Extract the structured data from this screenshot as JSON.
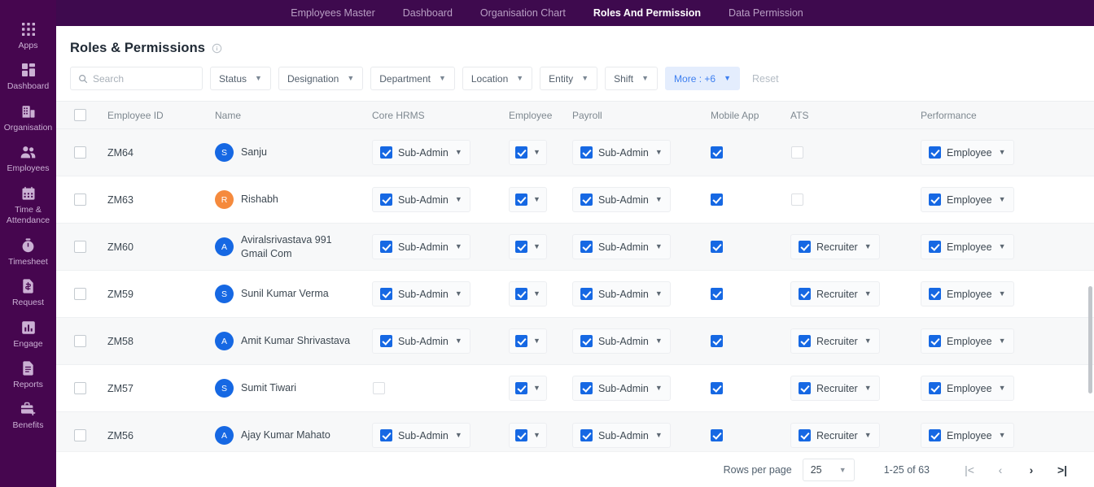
{
  "topnav": {
    "items": [
      {
        "label": "Employees Master",
        "active": false
      },
      {
        "label": "Dashboard",
        "active": false
      },
      {
        "label": "Organisation Chart",
        "active": false
      },
      {
        "label": "Roles And Permission",
        "active": true
      },
      {
        "label": "Data Permission",
        "active": false
      }
    ]
  },
  "sidebar": {
    "items": [
      {
        "label": "Apps",
        "icon": "apps-grid-icon"
      },
      {
        "label": "Dashboard",
        "icon": "dashboard-icon"
      },
      {
        "label": "Organisation",
        "icon": "building-icon"
      },
      {
        "label": "Employees",
        "icon": "people-icon"
      },
      {
        "label": "Time & Attendance",
        "icon": "calendar-icon"
      },
      {
        "label": "Timesheet",
        "icon": "stopwatch-icon"
      },
      {
        "label": "Request",
        "icon": "money-doc-icon"
      },
      {
        "label": "Engage",
        "icon": "bar-chart-icon"
      },
      {
        "label": "Reports",
        "icon": "document-icon"
      },
      {
        "label": "Benefits",
        "icon": "briefcase-plus-icon"
      }
    ]
  },
  "header": {
    "title": "Roles & Permissions",
    "info_icon": "info-circle-icon"
  },
  "filters": {
    "search_placeholder": "Search",
    "search_value": "",
    "chips": [
      {
        "label": "Status",
        "highlight": false
      },
      {
        "label": "Designation",
        "highlight": false
      },
      {
        "label": "Department",
        "highlight": false
      },
      {
        "label": "Location",
        "highlight": false
      },
      {
        "label": "Entity",
        "highlight": false
      },
      {
        "label": "Shift",
        "highlight": false
      },
      {
        "label": "More : +6",
        "highlight": true
      }
    ],
    "reset_label": "Reset"
  },
  "table": {
    "columns": [
      "Employee ID",
      "Name",
      "Core HRMS",
      "Employee",
      "Payroll",
      "Mobile App",
      "ATS",
      "Performance"
    ],
    "header_select_all": false,
    "rows": [
      {
        "selected": false,
        "employee_id": "ZM64",
        "name": "Sanju",
        "avatar_letter": "S",
        "avatar_color": "#1668e3",
        "core_hrms": {
          "checked": true,
          "label": "Sub-Admin"
        },
        "employee": {
          "checked": true
        },
        "payroll": {
          "checked": true,
          "label": "Sub-Admin"
        },
        "mobile_app": {
          "checked": true
        },
        "ats": {
          "checked": false,
          "label": ""
        },
        "performance": {
          "checked": true,
          "label": "Employee"
        }
      },
      {
        "selected": false,
        "employee_id": "ZM63",
        "name": "Rishabh",
        "avatar_letter": "R",
        "avatar_color": "#f58a3d",
        "core_hrms": {
          "checked": true,
          "label": "Sub-Admin"
        },
        "employee": {
          "checked": true
        },
        "payroll": {
          "checked": true,
          "label": "Sub-Admin"
        },
        "mobile_app": {
          "checked": true
        },
        "ats": {
          "checked": false,
          "label": ""
        },
        "performance": {
          "checked": true,
          "label": "Employee"
        }
      },
      {
        "selected": false,
        "employee_id": "ZM60",
        "name": "Aviralsrivastava 991 Gmail Com",
        "avatar_letter": "A",
        "avatar_color": "#1668e3",
        "core_hrms": {
          "checked": true,
          "label": "Sub-Admin"
        },
        "employee": {
          "checked": true
        },
        "payroll": {
          "checked": true,
          "label": "Sub-Admin"
        },
        "mobile_app": {
          "checked": true
        },
        "ats": {
          "checked": true,
          "label": "Recruiter"
        },
        "performance": {
          "checked": true,
          "label": "Employee"
        }
      },
      {
        "selected": false,
        "employee_id": "ZM59",
        "name": "Sunil Kumar Verma",
        "avatar_letter": "S",
        "avatar_color": "#1668e3",
        "core_hrms": {
          "checked": true,
          "label": "Sub-Admin"
        },
        "employee": {
          "checked": true
        },
        "payroll": {
          "checked": true,
          "label": "Sub-Admin"
        },
        "mobile_app": {
          "checked": true
        },
        "ats": {
          "checked": true,
          "label": "Recruiter"
        },
        "performance": {
          "checked": true,
          "label": "Employee"
        }
      },
      {
        "selected": false,
        "employee_id": "ZM58",
        "name": "Amit Kumar Shrivastava",
        "avatar_letter": "A",
        "avatar_color": "#1668e3",
        "core_hrms": {
          "checked": true,
          "label": "Sub-Admin"
        },
        "employee": {
          "checked": true
        },
        "payroll": {
          "checked": true,
          "label": "Sub-Admin"
        },
        "mobile_app": {
          "checked": true
        },
        "ats": {
          "checked": true,
          "label": "Recruiter"
        },
        "performance": {
          "checked": true,
          "label": "Employee"
        }
      },
      {
        "selected": false,
        "employee_id": "ZM57",
        "name": "Sumit Tiwari",
        "avatar_letter": "S",
        "avatar_color": "#1668e3",
        "core_hrms": {
          "checked": false,
          "label": ""
        },
        "employee": {
          "checked": true
        },
        "payroll": {
          "checked": true,
          "label": "Sub-Admin"
        },
        "mobile_app": {
          "checked": true
        },
        "ats": {
          "checked": true,
          "label": "Recruiter"
        },
        "performance": {
          "checked": true,
          "label": "Employee"
        }
      },
      {
        "selected": false,
        "employee_id": "ZM56",
        "name": "Ajay Kumar Mahato",
        "avatar_letter": "A",
        "avatar_color": "#1668e3",
        "core_hrms": {
          "checked": true,
          "label": "Sub-Admin"
        },
        "employee": {
          "checked": true
        },
        "payroll": {
          "checked": true,
          "label": "Sub-Admin"
        },
        "mobile_app": {
          "checked": true
        },
        "ats": {
          "checked": true,
          "label": "Recruiter"
        },
        "performance": {
          "checked": true,
          "label": "Employee"
        }
      }
    ]
  },
  "pagination": {
    "rows_per_page_label": "Rows per page",
    "rows_per_page_value": "25",
    "range_text": "1-25 of 63",
    "first_icon": "|<",
    "prev_icon": "‹",
    "next_icon": "›",
    "last_icon": ">|"
  },
  "colors": {
    "brand_purple": "#46064F",
    "topbar_purple": "#3E0A4E",
    "accent_blue": "#1668e3",
    "chip_blue_bg": "#e4edfd",
    "chip_blue_text": "#3d7ff0",
    "avatar_orange": "#f58a3d",
    "row_alt_bg": "#f7f8f9"
  }
}
